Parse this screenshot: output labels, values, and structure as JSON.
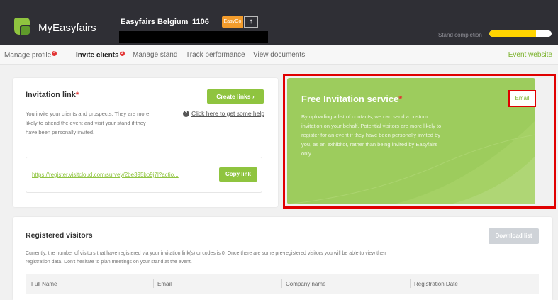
{
  "header": {
    "app_name": "MyEasyfairs",
    "event_name": "Easyfairs Belgium",
    "booth_number": "1106",
    "easygo_badge": "EasyGo",
    "upgrade_symbol": "↑",
    "stand_completion_label": "Stand completion",
    "stand_completion_progress": 0.75,
    "logo_icon": "easyfairs-logo-icon"
  },
  "nav": {
    "items": [
      {
        "label": "Manage profile",
        "badge": "4"
      },
      {
        "label": "Invite clients",
        "badge": "3"
      },
      {
        "label": "Manage stand"
      },
      {
        "label": "Track performance"
      },
      {
        "label": "View documents"
      }
    ],
    "event_website": "Event website"
  },
  "invitation": {
    "title": "Invitation link",
    "required_mark": "*",
    "create_links_button": "Create links  ›",
    "description": "You invite your clients and prospects. They are more likely to attend the event and visit your stand if they have been personally invited.",
    "help_icon": "help-circle-icon",
    "help_text": "Click here to get some help",
    "link_url": "https://register.visitcloud.com/survey/2be395bo9j7l?actio...",
    "copy_link_button": "Copy link"
  },
  "free_service": {
    "title": "Free Invitation service",
    "required_mark": "*",
    "description": "By uploading a list of contacts, we can send a custom invitation on your behalf. Potential visitors are more likely to register for an event if they have been personally invited by you, as an exhibitor, rather than being invited by Easyfairs only.",
    "email_button": "Email"
  },
  "registered": {
    "title": "Registered visitors",
    "download_button": "Download list",
    "description": "Currently, the number of visitors that have registered via your invitation link(s) or codes is 0. Once there are some pre-registered visitors you will be able to view their registration data. Don't hesitate to plan meetings on your stand at the event.",
    "columns": [
      "Full Name",
      "Email",
      "Company name",
      "Registration Date"
    ]
  },
  "colors": {
    "header_bg": "#2f2f35",
    "accent_green": "#8fc43f",
    "panel_green": "#9dcc5d",
    "easygo_orange": "#f39c2c",
    "progress_yellow": "#ffd400",
    "highlight_red": "#e00000"
  }
}
